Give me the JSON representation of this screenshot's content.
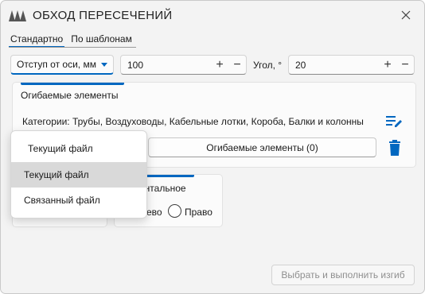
{
  "window": {
    "title": "ОБХОД ПЕРЕСЕЧЕНИЙ",
    "logo_icon": "logo-icon",
    "close_icon": "close-icon",
    "accent_color": "#0067c0"
  },
  "tabs": [
    {
      "label": "Стандартно",
      "active": true
    },
    {
      "label": "По шаблонам",
      "active": false
    }
  ],
  "offset": {
    "mode_label": "Отступ от оси, мм",
    "value": "100",
    "plus": "+",
    "minus": "−"
  },
  "angle": {
    "label": "Угол, °",
    "value": "20",
    "plus": "+",
    "minus": "−"
  },
  "elements_card": {
    "heading": "Огибаемые элементы",
    "categories": "Категории: Трубы, Воздуховоды, Кабельные лотки, Короба, Балки и колонны",
    "button_label": "Огибаемые элементы (0)",
    "edit_icon": "edit-list-icon",
    "delete_icon": "trash-icon"
  },
  "direction_card": {
    "heading_partial": "онтальное",
    "left_partial": "ево",
    "right_label": "Право"
  },
  "run_button": {
    "label": "Выбрать и выполнить изгиб",
    "enabled": false
  },
  "dropdown": {
    "items": [
      {
        "label": "Текущий файл",
        "state": "header"
      },
      {
        "label": "Текущий файл",
        "state": "selected"
      },
      {
        "label": "Связанный файл",
        "state": "normal"
      }
    ]
  }
}
